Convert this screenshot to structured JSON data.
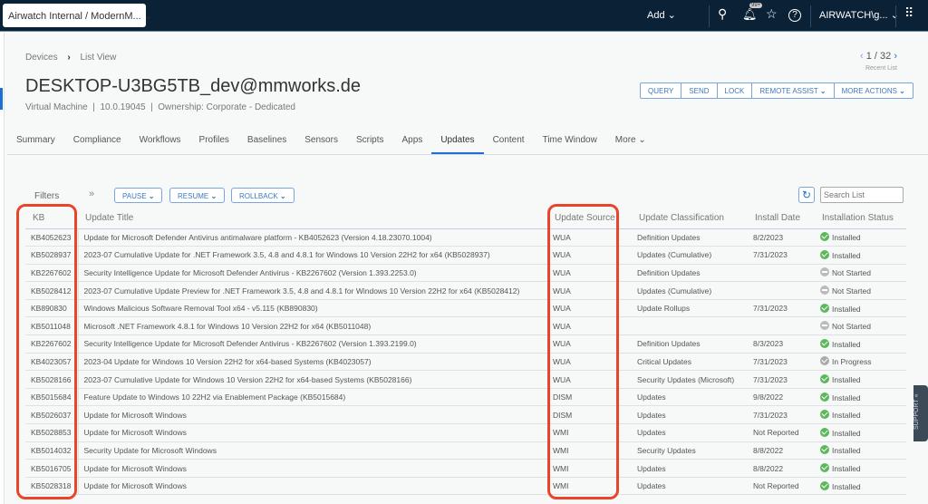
{
  "topbar": {
    "org": "Airwatch Internal / ModernM...",
    "add": "Add",
    "notif_badge": "99+",
    "user": "AIRWATCH\\g..."
  },
  "breadcrumb": {
    "root": "Devices",
    "current": "List View"
  },
  "pager": {
    "position": "1 / 32",
    "label": "Recent List"
  },
  "device": {
    "title": "DESKTOP-U3BG5TB_dev@mmworks.de",
    "type": "Virtual Machine",
    "os": "10.0.19045",
    "ownership": "Ownership: Corporate - Dedicated"
  },
  "actions": [
    "QUERY",
    "SEND",
    "LOCK",
    "REMOTE ASSIST",
    "MORE ACTIONS"
  ],
  "tabs": [
    "Summary",
    "Compliance",
    "Workflows",
    "Profiles",
    "Baselines",
    "Sensors",
    "Scripts",
    "Apps",
    "Updates",
    "Content",
    "Time Window",
    "More"
  ],
  "toolbar": {
    "filters": "Filters",
    "pause": "PAUSE",
    "resume": "RESUME",
    "rollback": "ROLLBACK",
    "search_placeholder": "Search List"
  },
  "columns": [
    "KB",
    "Update Title",
    "Update Source",
    "Update Classification",
    "Install Date",
    "Installation Status"
  ],
  "rows": [
    [
      "KB4052623",
      "Update for Microsoft Defender Antivirus antimalware platform - KB4052623 (Version 4.18.23070.1004)",
      "WUA",
      "Definition Updates",
      "8/2/2023",
      "Installed"
    ],
    [
      "KB5028937",
      "2023-07 Cumulative Update for .NET Framework 3.5, 4.8 and 4.8.1 for Windows 10 Version 22H2 for x64 (KB5028937)",
      "WUA",
      "Updates (Cumulative)",
      "7/31/2023",
      "Installed"
    ],
    [
      "KB2267602",
      "Security Intelligence Update for Microsoft Defender Antivirus - KB2267602 (Version 1.393.2253.0)",
      "WUA",
      "Definition Updates",
      "",
      "Not Started"
    ],
    [
      "KB5028412",
      "2023-07 Cumulative Update Preview for .NET Framework 3.5, 4.8 and 4.8.1 for Windows 10 Version 22H2 for x64 (KB5028412)",
      "WUA",
      "Updates (Cumulative)",
      "",
      "Not Started"
    ],
    [
      "KB890830",
      "Windows Malicious Software Removal Tool x64 - v5.115 (KB890830)",
      "WUA",
      "Update Rollups",
      "7/31/2023",
      "Installed"
    ],
    [
      "KB5011048",
      "Microsoft .NET Framework 4.8.1 for Windows 10 Version 22H2 for x64 (KB5011048)",
      "WUA",
      "",
      "",
      "Not Started"
    ],
    [
      "KB2267602",
      "Security Intelligence Update for Microsoft Defender Antivirus - KB2267602 (Version 1.393.2199.0)",
      "WUA",
      "Definition Updates",
      "8/3/2023",
      "Installed"
    ],
    [
      "KB4023057",
      "2023-04 Update for Windows 10 Version 22H2 for x64-based Systems (KB4023057)",
      "WUA",
      "Critical Updates",
      "7/31/2023",
      "In Progress"
    ],
    [
      "KB5028166",
      "2023-07 Cumulative Update for Windows 10 Version 22H2 for x64-based Systems (KB5028166)",
      "WUA",
      "Security Updates (Microsoft)",
      "7/31/2023",
      "Installed"
    ],
    [
      "KB5015684",
      "Feature Update to Windows 10 22H2 via Enablement Package (KB5015684)",
      "DISM",
      "Updates",
      "9/8/2022",
      "Installed"
    ],
    [
      "KB5026037",
      "Update for Microsoft Windows",
      "DISM",
      "Updates",
      "7/31/2023",
      "Installed"
    ],
    [
      "KB5028853",
      "Update for Microsoft Windows",
      "WMI",
      "Updates",
      "Not Reported",
      "Installed"
    ],
    [
      "KB5014032",
      "Security Update for Microsoft Windows",
      "WMI",
      "Security Updates",
      "8/8/2022",
      "Installed"
    ],
    [
      "KB5016705",
      "Update for Microsoft Windows",
      "WMI",
      "Updates",
      "8/8/2022",
      "Installed"
    ],
    [
      "KB5028318",
      "Update for Microsoft Windows",
      "WMI",
      "Updates",
      "Not Reported",
      "Installed"
    ]
  ],
  "support": "SUPPORT",
  "colors": {
    "highlight": "#e8452a",
    "accent": "#1d6fd1",
    "topbar": "#0b2135"
  }
}
